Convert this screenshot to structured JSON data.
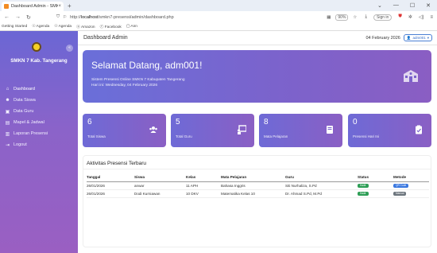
{
  "browser": {
    "tab_title": "Dashboard Admin - SMKN 7 Ka",
    "tab_close": "×",
    "new_tab": "+",
    "url_prefix": "http://",
    "url_host": "localhost",
    "url_path": "/smkn7-presensi/admin/dashboard.php",
    "zoom": "90%",
    "sign_in": "Sign in",
    "bookmarks": [
      "Getting Started",
      "Agenda",
      "Agenda",
      "Amazon",
      "Facebook",
      "Ann"
    ]
  },
  "sidebar": {
    "school_name": "SMKN 7 Kab. Tangerang",
    "collapse_label": "«",
    "items": [
      {
        "label": "Dashboard",
        "icon": "home-icon"
      },
      {
        "label": "Data Siswa",
        "icon": "users-icon"
      },
      {
        "label": "Data Guru",
        "icon": "chalkboard-icon"
      },
      {
        "label": "Mapel & Jadwal",
        "icon": "book-icon"
      },
      {
        "label": "Laporan Presensi",
        "icon": "report-icon"
      },
      {
        "label": "Logout",
        "icon": "logout-icon"
      }
    ]
  },
  "header": {
    "title": "Dashboard Admin",
    "date": "04 February 2026",
    "user": "adm001"
  },
  "hero": {
    "title": "Selamat Datang, adm001!",
    "line1": "Sistem Presensi Online SMKN 7 Kabupaten Tangerang",
    "line2": "Hari ini: Wednesday, 04 February 2026"
  },
  "cards": [
    {
      "value": "6",
      "label": "Total Siswa",
      "icon": "users-icon"
    },
    {
      "value": "5",
      "label": "Total Guru",
      "icon": "chalkboard-teacher-icon"
    },
    {
      "value": "8",
      "label": "Mata Pelajaran",
      "icon": "book-icon"
    },
    {
      "value": "0",
      "label": "Presensi Hari Ini",
      "icon": "clipboard-check-icon"
    }
  ],
  "activity": {
    "title": "Aktivitas Presensi Terbaru",
    "columns": [
      "Tanggal",
      "Siswa",
      "Kelas",
      "Mata Pelajaran",
      "Guru",
      "Status",
      "Metode"
    ],
    "rows": [
      {
        "tanggal": "26/01/2026",
        "siswa": "anwar",
        "kelas": "11 APH",
        "mapel": "Bahasa Inggris",
        "guru": "Siti Nurhaliza, S.Pd",
        "status": "Hadir",
        "metode": "QR Code",
        "metode_color": "#3a78e0"
      },
      {
        "tanggal": "26/01/2026",
        "siswa": "Dodi Kurniawan",
        "kelas": "10 DKV",
        "mapel": "Matematika Kelas 10",
        "guru": "Dr. Ahmad S.Pd, M.Pd",
        "status": "Hadir",
        "metode": "Manual",
        "metode_color": "#6c757d"
      }
    ]
  },
  "colors": {
    "accent": "#6b66d4",
    "accent2": "#9a5fc2",
    "success": "#2e9e56"
  }
}
